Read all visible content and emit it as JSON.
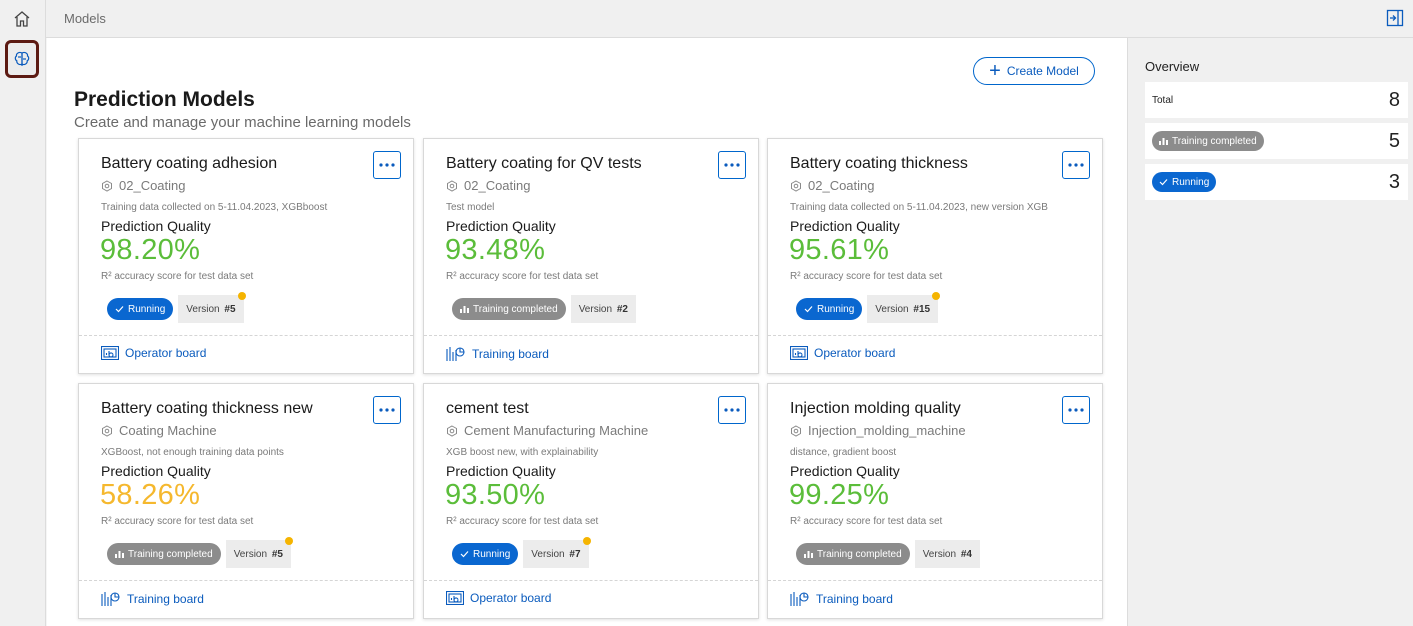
{
  "breadcrumb": "Models",
  "page": {
    "title": "Prediction Models",
    "subtitle": "Create and manage your machine learning models",
    "create_button": "Create Model"
  },
  "colors": {
    "accent": "#0a5bbd",
    "running": "#0a67d0",
    "training": "#8c8c8c",
    "score_good": "#5bbd3a",
    "score_warn": "#f5b82e",
    "dot": "#f5b400"
  },
  "common": {
    "prediction_quality": "Prediction Quality",
    "r2_text": "R² accuracy score for test data set",
    "version_prefix": "Version"
  },
  "cards": [
    {
      "title": "Battery coating adhesion",
      "machine": "02_Coating",
      "description": "Training data collected on 5-11.04.2023, XGBboost",
      "score": "98.20%",
      "score_level": "good",
      "status": "Running",
      "version": "#5",
      "version_dot": true,
      "link": "Operator board",
      "link_icon": "operator-board-icon"
    },
    {
      "title": "Battery coating for QV tests",
      "machine": "02_Coating",
      "description": "Test model",
      "score": "93.48%",
      "score_level": "good",
      "status": "Training completed",
      "version": "#2",
      "version_dot": false,
      "link": "Training board",
      "link_icon": "training-board-icon"
    },
    {
      "title": "Battery coating thickness",
      "machine": "02_Coating",
      "description": "Training data collected on 5-11.04.2023, new version XGB",
      "score": "95.61%",
      "score_level": "good",
      "status": "Running",
      "version": "#15",
      "version_dot": true,
      "link": "Operator board",
      "link_icon": "operator-board-icon"
    },
    {
      "title": "Battery coating thickness new",
      "machine": "Coating Machine",
      "description": "XGBoost, not enough training data points",
      "score": "58.26%",
      "score_level": "warn",
      "status": "Training completed",
      "version": "#5",
      "version_dot": true,
      "link": "Training board",
      "link_icon": "training-board-icon"
    },
    {
      "title": "cement test",
      "machine": "Cement Manufacturing Machine",
      "description": "XGB boost new, with explainability",
      "score": "93.50%",
      "score_level": "good",
      "status": "Running",
      "version": "#7",
      "version_dot": true,
      "link": "Operator board",
      "link_icon": "operator-board-icon"
    },
    {
      "title": "Injection molding quality",
      "machine": "Injection_molding_machine",
      "description": "distance, gradient boost",
      "score": "99.25%",
      "score_level": "good",
      "status": "Training completed",
      "version": "#4",
      "version_dot": false,
      "link": "Training board",
      "link_icon": "training-board-icon"
    }
  ],
  "overview": {
    "title": "Overview",
    "total_label": "Total",
    "total": "8",
    "training_label": "Training completed",
    "training_count": "5",
    "running_label": "Running",
    "running_count": "3"
  }
}
